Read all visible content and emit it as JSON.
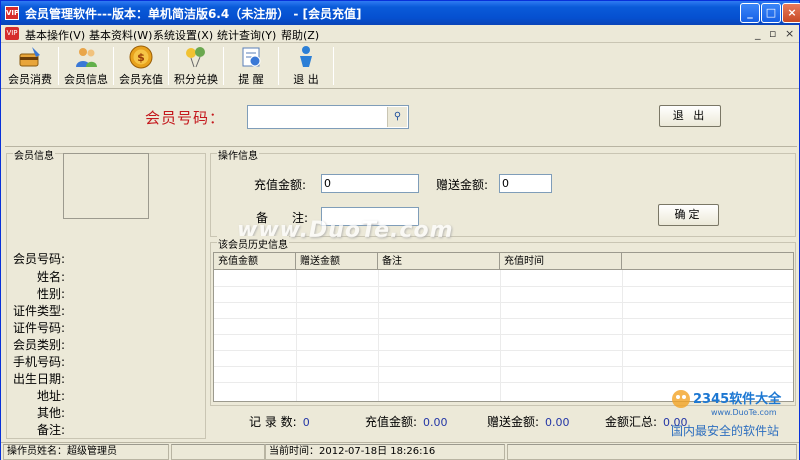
{
  "window": {
    "title": "会员管理软件---版本：单机简洁版6.4（未注册） - [会员充值]",
    "app_icon_text": "VIP"
  },
  "menu": {
    "items": [
      "基本操作(V)",
      "基本资料(W)",
      "系统设置(X)",
      "统计查询(Y)",
      "帮助(Z)"
    ],
    "mdi_controls": [
      "_",
      "▫",
      "×"
    ]
  },
  "toolbar": {
    "items": [
      {
        "label": "会员消费",
        "icon": "card-swipe-icon"
      },
      {
        "label": "会员信息",
        "icon": "users-icon"
      },
      {
        "label": "会员充值",
        "icon": "coin-icon"
      },
      {
        "label": "积分兑换",
        "icon": "balloons-icon"
      },
      {
        "label": "提 醒",
        "icon": "reminder-icon"
      },
      {
        "label": "退 出",
        "icon": "exit-person-icon"
      }
    ]
  },
  "search": {
    "label": "会员号码：",
    "value": "",
    "exit_button": "退 出"
  },
  "member_info": {
    "group_title": "会员信息",
    "fields": [
      "会员号码:",
      "姓名:",
      "性别:",
      "证件类型:",
      "证件号码:",
      "会员类别:",
      "手机号码:",
      "出生日期:",
      "地址:",
      "其他:",
      "备注:"
    ]
  },
  "operation": {
    "group_title": "操作信息",
    "recharge_label": "充值金额:",
    "recharge_value": "0",
    "bonus_label": "赠送金额:",
    "bonus_value": "0",
    "note_label": "备　　注:",
    "note_value": "",
    "confirm_button": "确定"
  },
  "history": {
    "group_title": "该会员历史信息",
    "columns": [
      "充值金额",
      "赠送金额",
      "备注",
      "充值时间"
    ],
    "rows": []
  },
  "summary": {
    "records_label": "记 录 数:",
    "records_value": "0",
    "recharge_label": "充值金额:",
    "recharge_value": "0.00",
    "bonus_label": "赠送金额:",
    "bonus_value": "0.00",
    "total_label": "金额汇总:",
    "total_value": "0.00"
  },
  "statusbar": {
    "operator": "操作员姓名：超级管理员",
    "current_time": "当前时间：2012-07-18日 18:26:16"
  },
  "watermarks": {
    "center": "www.DuoTe.com",
    "corner_brand": "2345软件大全",
    "corner_url": "www.DuoTe.com",
    "corner_slogan": "国内最安全的软件站"
  },
  "colors": {
    "titlebar": "#0550d0",
    "label_red": "#c4181d",
    "value_blue": "#2437a6"
  }
}
